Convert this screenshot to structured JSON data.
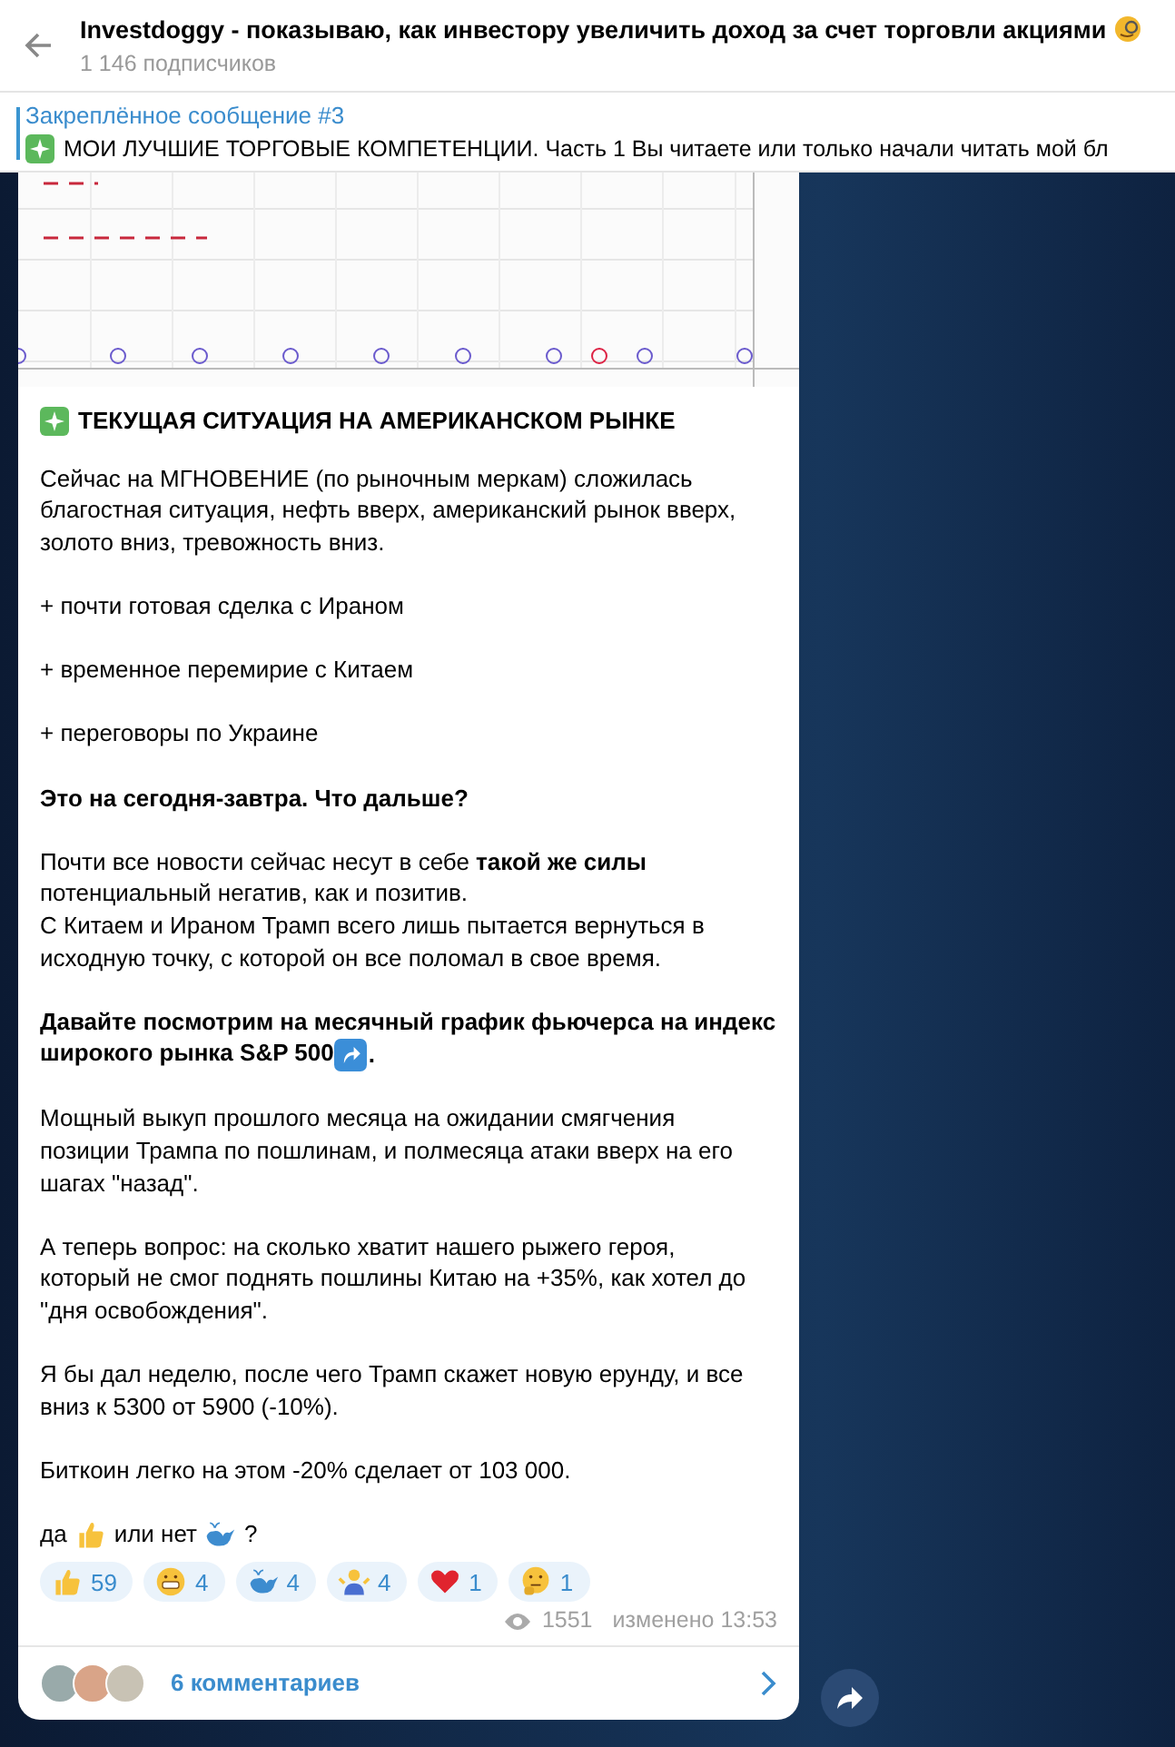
{
  "header": {
    "title": "Investdoggy - показываю, как инвестору увеличить доход за счет торговли акциями",
    "subtitle": "1 146 подписчиков"
  },
  "pinned": {
    "label": "Закреплённое сообщение #3",
    "text": "МОИ ЛУЧШИЕ ТОРГОВЫЕ КОМПЕТЕНЦИИ. Часть 1  Вы читаете или только начали читать мой бл"
  },
  "post": {
    "title": "ТЕКУЩАЯ СИТУАЦИЯ НА АМЕРИКАНСКОМ РЫНКЕ",
    "paragraphs": [
      {
        "lines": [
          "Сейчас на МГНОВЕНИЕ (по рыночным меркам) сложилась",
          "благостная ситуация, нефть вверх, американский рынок вверх,",
          "золото вниз, тревожность вниз."
        ]
      },
      {
        "lines": [
          "+ почти готовая сделка с Ираном"
        ]
      },
      {
        "lines": [
          "+ временное перемирие с Китаем"
        ]
      },
      {
        "lines": [
          "+ переговоры по Украине"
        ]
      },
      {
        "lines": [
          "**Это на сегодня-завтра. Что дальше?**"
        ]
      },
      {
        "lines": [
          "Почти все новости сейчас несут в себе **такой же силы**",
          "потенциальный негатив, как и позитив.",
          "С Китаем и Ираном Трамп всего лишь пытается вернуться в",
          "исходную точку, с которой он все поломал в свое время."
        ]
      },
      {
        "lines": [
          "**Давайте посмотрим на месячный график фьючерса на индекс**",
          "**широкого рынка S&P 500**"
        ],
        "kind": "arrow",
        "trail_text": "."
      },
      {
        "lines": [
          "Мощный выкуп прошлого месяца на ожидании смягчения",
          "позиции Трампа по пошлинам, и полмесяца атаки вверх на его",
          "шагах \"назад\"."
        ]
      },
      {
        "lines": [
          "А теперь вопрос: на сколько хватит нашего рыжего героя,",
          "который не смог поднять пошлины Китаю на +35%, как хотел до",
          "\"дня освобождения\"."
        ]
      },
      {
        "lines": [
          "Я бы дал неделю, после чего Трамп скажет новую ерунду, и все",
          "вниз к 5300 от 5900 (-10%)."
        ]
      },
      {
        "lines": [
          "Биткоин легко на этом -20% сделает от 103 000."
        ]
      }
    ],
    "poll": {
      "yes": "да",
      "no": "или нет",
      "end": "?"
    },
    "reactions": [
      {
        "kind": "thumb",
        "count": "59"
      },
      {
        "kind": "grin",
        "count": "4"
      },
      {
        "kind": "whale",
        "count": "4"
      },
      {
        "kind": "shrug",
        "count": "4"
      },
      {
        "kind": "heart",
        "count": "1"
      },
      {
        "kind": "thinking",
        "count": "1"
      }
    ],
    "views": "1551",
    "edited": "изменено 13:53",
    "comments": "6 комментариев"
  }
}
